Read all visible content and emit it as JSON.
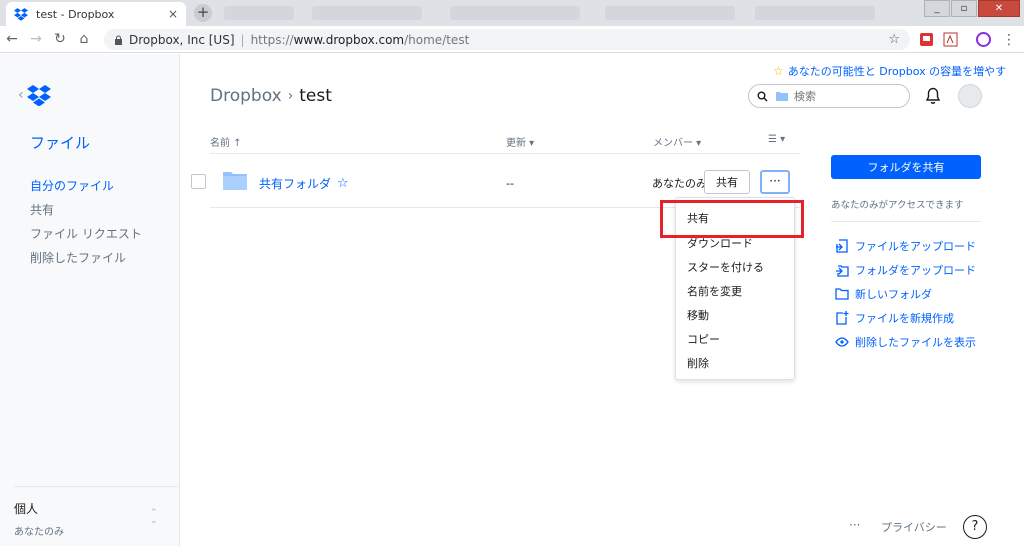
{
  "browser": {
    "tab_title": "test - Dropbox",
    "tab_close": "×",
    "new_tab": "+",
    "site_name": "Dropbox, Inc [US]",
    "url_protocol": "https://",
    "url_host": "www.dropbox.com",
    "url_path": "/home/test",
    "window_min": "_",
    "window_max": "▫",
    "window_close": "✕"
  },
  "sidebar": {
    "files_title": "ファイル",
    "nav": [
      "自分のファイル",
      "共有",
      "ファイル リクエスト",
      "削除したファイル"
    ],
    "account_name": "個人",
    "account_sub": "あなたのみ"
  },
  "header": {
    "promo": "あなたの可能性と Dropbox の容量を増やす",
    "breadcrumb_root": "Dropbox",
    "breadcrumb_current": "test",
    "search_placeholder": "検索"
  },
  "table": {
    "col_name": "名前 ↑",
    "col_modified": "更新 ▾",
    "col_members": "メンバー ▾",
    "view_toggle": "☰ ▾",
    "row": {
      "name": "共有フォルダ",
      "modified": "--",
      "members": "あなたのみ",
      "share_label": "共有",
      "more_label": "···"
    }
  },
  "context_menu": [
    "共有",
    "ダウンロード",
    "スターを付ける",
    "名前を変更",
    "移動",
    "コピー",
    "削除"
  ],
  "right_panel": {
    "share_folder": "フォルダを共有",
    "access_note": "あなたのみがアクセスできます",
    "actions": [
      "ファイルをアップロード",
      "フォルダをアップロード",
      "新しいフォルダ",
      "ファイルを新規作成",
      "削除したファイルを表示"
    ]
  },
  "footer": {
    "more": "···",
    "privacy": "プライバシー",
    "help": "?"
  },
  "colors": {
    "accent": "#0061fe",
    "highlight": "#e8202a"
  }
}
